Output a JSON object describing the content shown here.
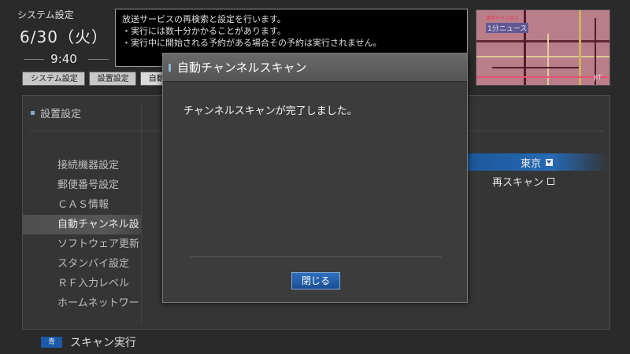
{
  "clock": {
    "label": "システム設定",
    "date": "6/30（火）",
    "time": "9:40"
  },
  "info": {
    "lines": [
      "放送サービスの再検索と設定を行います。",
      "・実行には数十分かかることがあります。",
      "・実行中に開始される予約がある場合その予約は実行されません。"
    ]
  },
  "preview": {
    "logo": "某地チャンネル",
    "caption": "1分ニュース",
    "tag": "JIT"
  },
  "breadcrumb": [
    "システム設定",
    "設置設定",
    "自動チ"
  ],
  "panel": {
    "title": "設置設定",
    "menu": [
      "接続機器設定",
      "郵便番号設定",
      "ＣＡＳ情報",
      "自動チャンネル設",
      "ソフトウェア更新",
      "スタンバイ設定",
      "ＲＦ入力レベル",
      "ホームネットワー"
    ],
    "selected_index": 3,
    "region_value": "東京",
    "rescan_label": "再スキャン"
  },
  "footer": {
    "key": "青",
    "label": "スキャン実行"
  },
  "dialog": {
    "title": "自動チャンネルスキャン",
    "message": "チャンネルスキャンが完了しました。",
    "close_label": "閉じる"
  },
  "colors": {
    "accent_blue": "#1d62b6",
    "background": "#2e2e2e",
    "info_bg": "#000000"
  }
}
